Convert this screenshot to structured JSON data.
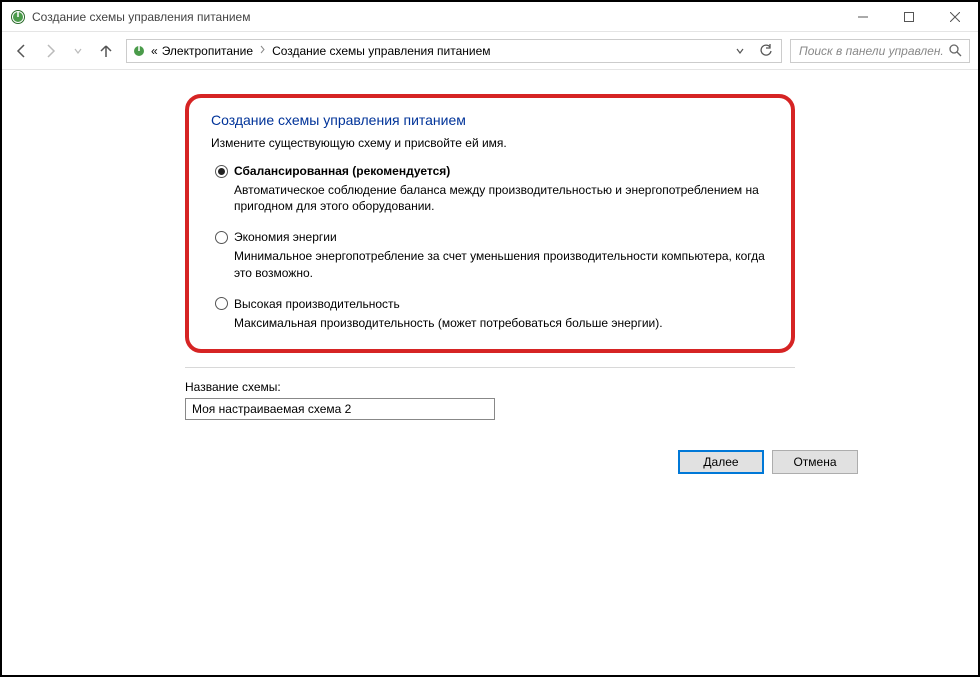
{
  "window": {
    "title": "Создание схемы управления питанием"
  },
  "nav": {
    "breadcrumb_prefix": "«",
    "crumb1": "Электропитание",
    "crumb2": "Создание схемы управления питанием",
    "search_placeholder": "Поиск в панели управлен..."
  },
  "page": {
    "heading": "Создание схемы управления питанием",
    "subheading": "Измените существующую схему и присвойте ей имя."
  },
  "plans": [
    {
      "name": "Сбалансированная (рекомендуется)",
      "desc": "Автоматическое соблюдение баланса между производительностью и энергопотреблением на пригодном для этого оборудовании.",
      "checked": true,
      "bold": true
    },
    {
      "name": "Экономия энергии",
      "desc": "Минимальное энергопотребление за счет уменьшения производительности компьютера, когда это возможно.",
      "checked": false,
      "bold": false
    },
    {
      "name": "Высокая производительность",
      "desc": "Максимальная производительность (может потребоваться больше энергии).",
      "checked": false,
      "bold": false
    }
  ],
  "name_field": {
    "label": "Название схемы:",
    "value": "Моя настраиваемая схема 2"
  },
  "buttons": {
    "next": "Далее",
    "cancel": "Отмена"
  }
}
